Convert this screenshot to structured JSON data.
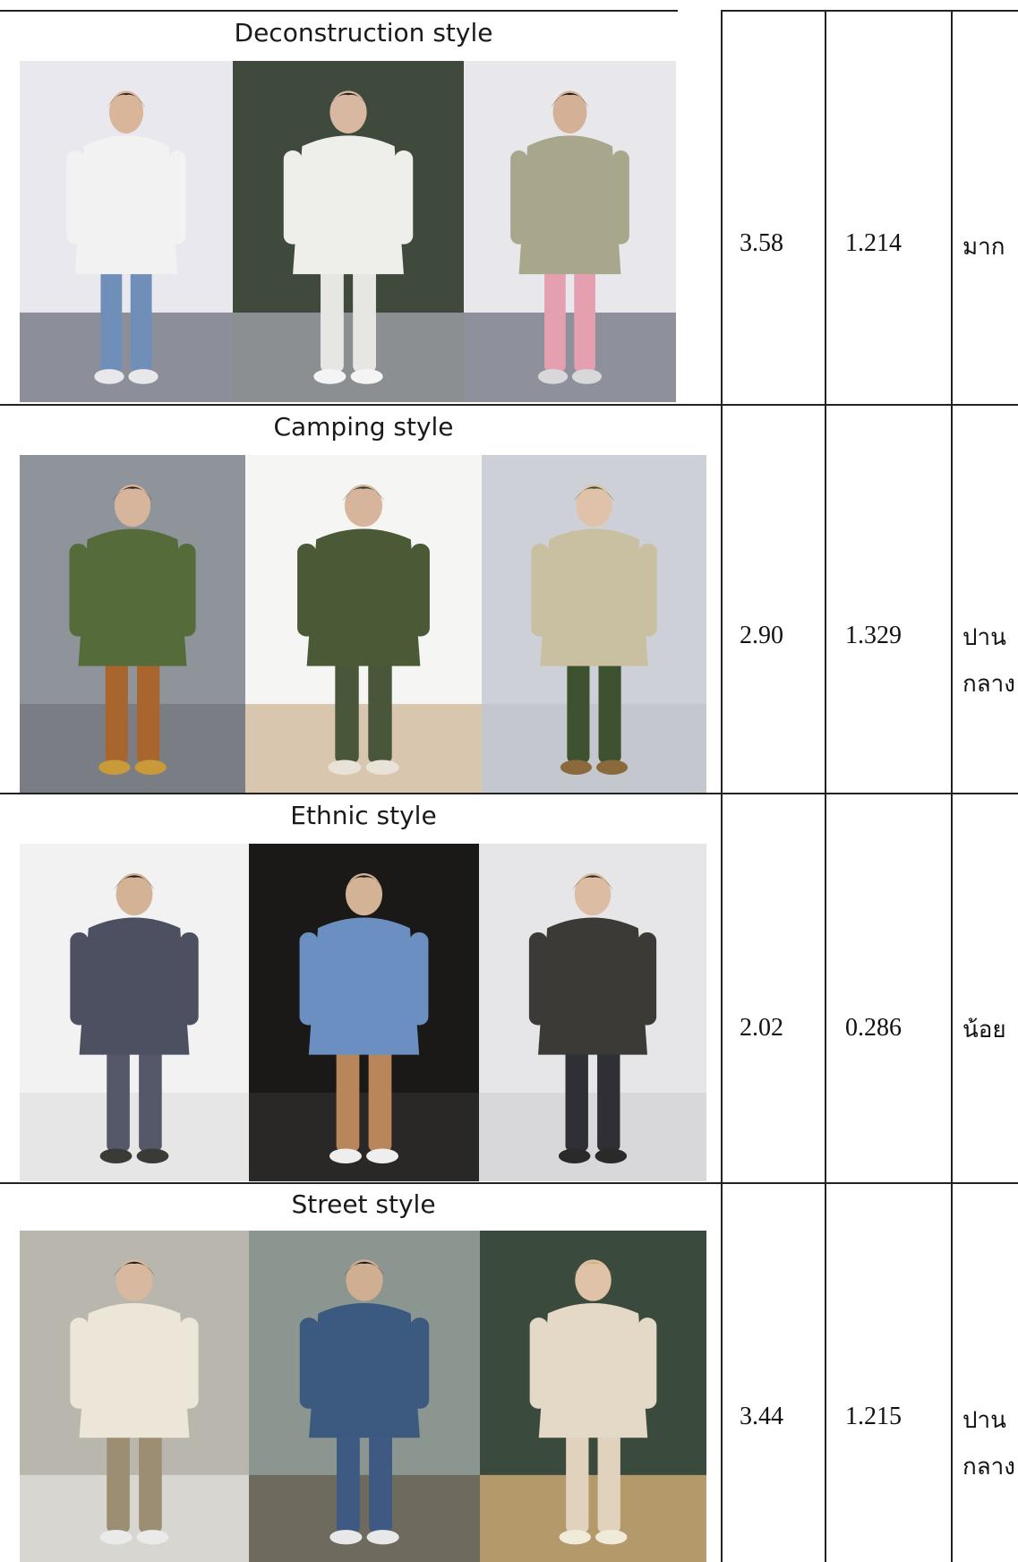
{
  "rows": [
    {
      "style": "Deconstruction style",
      "mean": "3.58",
      "sd": "1.214",
      "level": "มาก",
      "photos": [
        {
          "bg": "#e9e8ee",
          "floor": "#8c8e9a",
          "top": "#f2f2f2",
          "bottom": "#6f8fb8",
          "skin": "#d9b59a",
          "hair": "#3a2a22",
          "shoes": "#e8e8ea"
        },
        {
          "bg": "#3f4a3c",
          "floor": "#8b8f92",
          "top": "#eeeeea",
          "bottom": "#e6e6e2",
          "skin": "#d8b8a0",
          "hair": "#1e1a18",
          "shoes": "#f4f4f4"
        },
        {
          "bg": "#e8e7ec",
          "floor": "#8e909c",
          "top": "#a8a78c",
          "bottom": "#e5a0b0",
          "skin": "#d4b096",
          "hair": "#1c1a18",
          "shoes": "#d8d8da"
        }
      ]
    },
    {
      "style": "Camping style",
      "mean": "2.90",
      "sd": "1.329",
      "level": "ปาน\nกลาง",
      "photos": [
        {
          "bg": "#8f949a",
          "floor": "#7a7e84",
          "top": "#556b3a",
          "bottom": "#a8662e",
          "skin": "#d7b59c",
          "hair": "#2a211c",
          "shoes": "#c89a3a"
        },
        {
          "bg": "#f5f5f3",
          "floor": "#d8c7ae",
          "top": "#4b5a36",
          "bottom": "#48563a",
          "skin": "#d7b59c",
          "hair": "#2d3a22",
          "shoes": "#e8e2d8"
        },
        {
          "bg": "#cdd0d6",
          "floor": "#c4c7cd",
          "top": "#c8c0a0",
          "bottom": "#3f5230",
          "skin": "#e0c2aa",
          "hair": "#394a2a",
          "shoes": "#8a6a3c"
        }
      ]
    },
    {
      "style": "Ethnic style",
      "mean": "2.02",
      "sd": "0.286",
      "level": "น้อย",
      "photos": [
        {
          "bg": "#f2f2f2",
          "floor": "#e6e6e6",
          "top": "#4c5060",
          "bottom": "#555868",
          "skin": "#d4b296",
          "hair": "#1c1816",
          "shoes": "#3a3a36"
        },
        {
          "bg": "#1a1918",
          "floor": "#2a2826",
          "top": "#6b8fc0",
          "bottom": "#b9855a",
          "skin": "#d4b296",
          "hair": "#1a1614",
          "shoes": "#eeeeee"
        },
        {
          "bg": "#e6e6e8",
          "floor": "#d8d8da",
          "top": "#3c3a36",
          "bottom": "#2e3036",
          "skin": "#dcbca2",
          "hair": "#2a221c",
          "shoes": "#2a2a2a"
        }
      ]
    },
    {
      "style": "Street style",
      "mean": "3.44",
      "sd": "1.215",
      "level": "ปาน\nกลาง",
      "photos": [
        {
          "bg": "#b9b6ae",
          "floor": "#d8d6d0",
          "top": "#ece6d8",
          "bottom": "#9c8e72",
          "skin": "#d8b89e",
          "hair": "#1e1a18",
          "shoes": "#eaeaea"
        },
        {
          "bg": "#8c9690",
          "floor": "#6e6a5e",
          "top": "#3c5a80",
          "bottom": "#3e5a82",
          "skin": "#d0ae92",
          "hair": "#1e1a18",
          "shoes": "#e8e8e8"
        },
        {
          "bg": "#3a4a3c",
          "floor": "#b49a6a",
          "top": "#e4d8c6",
          "bottom": "#e0d2bc",
          "skin": "#e0c2a8",
          "hair": "#c8b46a",
          "shoes": "#f0ead8"
        }
      ]
    }
  ]
}
